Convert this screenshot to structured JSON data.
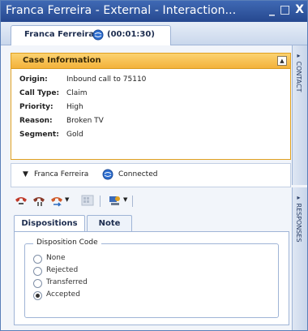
{
  "window": {
    "title": "Franca Ferreira - External - Interaction...",
    "min_glyph": "_",
    "max_glyph": "□",
    "close_glyph": "X"
  },
  "tab": {
    "name": "Franca Ferreira",
    "timer": "(00:01:30)"
  },
  "side_panels": {
    "contact": "▸ CONTACT",
    "responses": "▸ RESPONSES"
  },
  "case_info": {
    "title": "Case Information",
    "collapse_glyph": "▲",
    "fields": [
      {
        "key": "Origin:",
        "value": "Inbound call to 75110"
      },
      {
        "key": "Call Type:",
        "value": "Claim"
      },
      {
        "key": "Priority:",
        "value": "High"
      },
      {
        "key": "Reason:",
        "value": "Broken TV"
      },
      {
        "key": "Segment:",
        "value": "Gold"
      }
    ]
  },
  "connection": {
    "arrow": "▼",
    "name": "Franca Ferreira",
    "status": "Connected"
  },
  "subtabs": {
    "dispositions": "Dispositions",
    "note": "Note"
  },
  "disposition": {
    "legend": "Disposition Code",
    "options": [
      "None",
      "Rejected",
      "Transferred",
      "Accepted"
    ],
    "selected": "Accepted"
  },
  "colors": {
    "accent": "#2a4c94",
    "case_border": "#e0a020"
  },
  "icons": [
    "phone-hangup-icon",
    "phone-hold-icon",
    "phone-transfer-icon",
    "keypad-icon",
    "conference-icon",
    "globe-icon"
  ]
}
